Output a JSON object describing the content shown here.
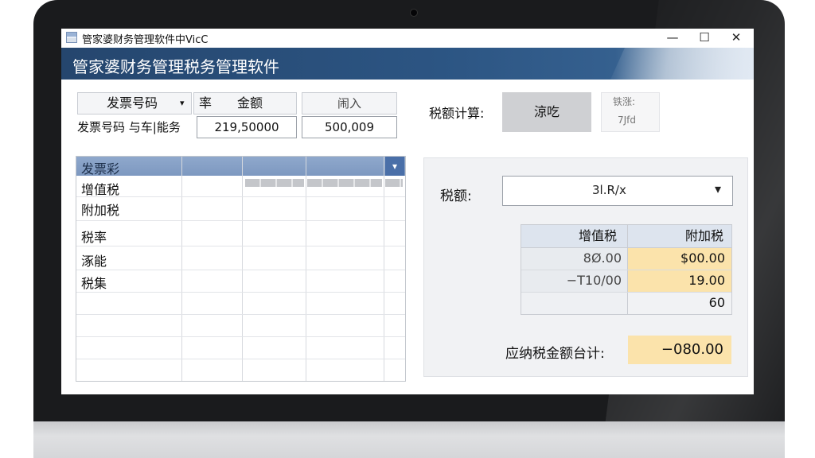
{
  "window": {
    "title": "管家婆财务管理软件中VicC",
    "minimize": "—",
    "maximize": "☐",
    "close": "✕"
  },
  "banner": {
    "title": "管家婆财务管理税务管理软件"
  },
  "invoice_form": {
    "field_label": "发票号码",
    "field_dropdown": "▾",
    "rate_label": "率",
    "amount_label": "金额",
    "import_button": "闹入",
    "row_label": "发票号码 与车|能务",
    "amount_value": "219,50000",
    "import_value": "500,009"
  },
  "tax_calc": {
    "label": "税额计算:",
    "button": "涼吃",
    "side_top": "铁涨:",
    "side_bottom": "7Jfd"
  },
  "grid": {
    "header_label": "发票彩",
    "header_dropdown": "▾",
    "rows": [
      "增值税",
      "附加税",
      "税率",
      "涿能",
      "税集"
    ]
  },
  "tax_panel": {
    "tax_label": "税额:",
    "dropdown_value": "3l.R/x",
    "dropdown_arrow": "▾",
    "col_vat": "增值税",
    "col_surcharge": "附加税",
    "row1_vat": "8Ø.00",
    "row1_surcharge": "$00.00",
    "row2_vat": "−T10/00",
    "row2_surcharge": "19.00",
    "row3_surcharge": "60",
    "total_label": "应纳税金额台计:",
    "total_value": "−080.00"
  }
}
